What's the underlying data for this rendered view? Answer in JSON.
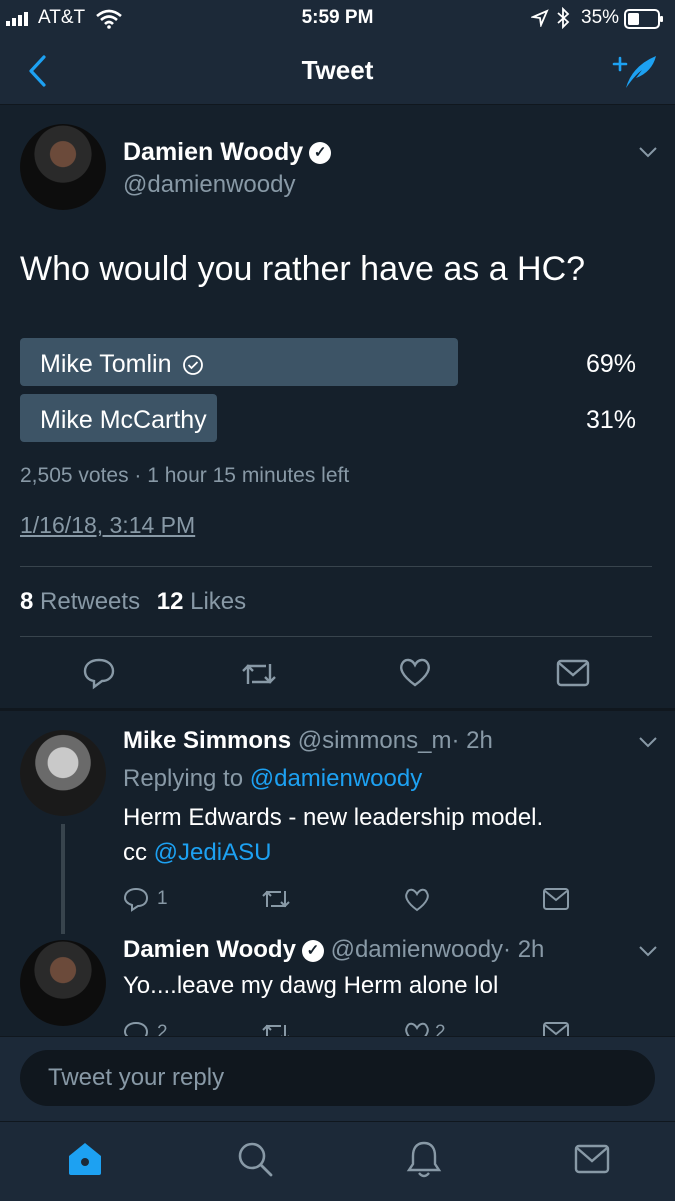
{
  "status_bar": {
    "carrier": "AT&T",
    "time": "5:59 PM",
    "battery": "35%"
  },
  "nav": {
    "title": "Tweet"
  },
  "tweet": {
    "author_name": "Damien Woody",
    "author_handle": "@damienwoody",
    "text": "Who would you rather have as a HC?",
    "poll": {
      "options": [
        {
          "label": "Mike Tomlin",
          "percent_text": "69%",
          "percent": 69,
          "winner": true
        },
        {
          "label": "Mike McCarthy",
          "percent_text": "31%",
          "percent": 31,
          "winner": false
        }
      ],
      "summary": "2,505 votes · 1 hour 15 minutes left"
    },
    "timestamp": "1/16/18, 3:14 PM",
    "retweets_count": "8",
    "retweets_label": "Retweets",
    "likes_count": "12",
    "likes_label": "Likes"
  },
  "replies": [
    {
      "author_name": "Mike Simmons",
      "author_handle": "@simmons_m",
      "time": "· 2h",
      "replying_prefix": "Replying to",
      "replying_to": "@damienwoody",
      "text_line1": "Herm Edwards - new leadership model.",
      "text_line2_prefix": "cc",
      "text_line2_mention": "@JediASU",
      "reply_count": "1"
    },
    {
      "author_name": "Damien Woody",
      "author_handle": "@damienwoody",
      "time": "· 2h",
      "text": "Yo....leave my dawg Herm alone lol",
      "reply_count": "2",
      "like_count": "2"
    }
  ],
  "reply_box": {
    "placeholder": "Tweet your reply"
  },
  "colors": {
    "background": "#15202b",
    "bar": "#1c2938",
    "accent": "#1da1f2",
    "muted": "#8899a6",
    "poll_bar": "#3d5466"
  }
}
